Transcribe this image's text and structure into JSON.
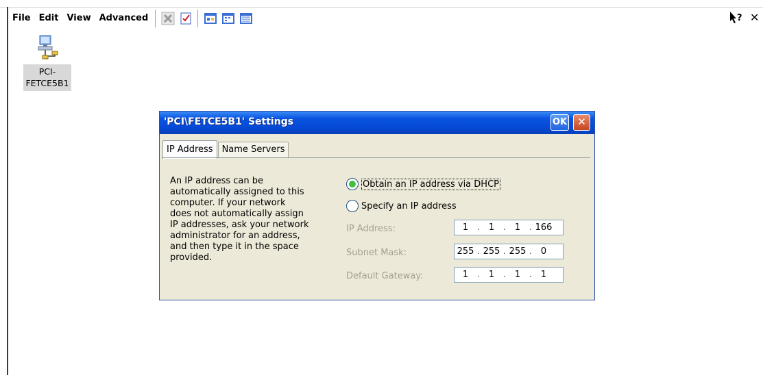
{
  "menu": {
    "file": "File",
    "edit": "Edit",
    "view": "View",
    "advanced": "Advanced"
  },
  "toolbar": {
    "icons": [
      "delete-icon",
      "properties-icon",
      "large-icons-view-icon",
      "small-icons-view-icon",
      "details-view-icon"
    ],
    "help_icon": "help-pointer-icon",
    "close_icon": "close-icon",
    "help_label": "?",
    "close_label": "✕"
  },
  "desktop": {
    "icon_label": "PCI-\nFETCE5B1",
    "icon_name": "network-adapter-icon"
  },
  "dialog": {
    "title": "'PCI\\FETCE5B1' Settings",
    "ok_label": "OK",
    "close_label": "✕",
    "tabs": [
      "IP Address",
      "Name Servers"
    ],
    "description": "An IP address can be\nautomatically assigned to this\ncomputer.  If your network\ndoes not automatically assign\nIP addresses, ask your network\nadministrator for an address,\nand then type it in the space\nprovided.",
    "radio_dhcp": "Obtain an IP address via DHCP",
    "radio_specify": "Specify an IP address",
    "radio_selected": "dhcp",
    "ip_label": "IP Address:",
    "subnet_label": "Subnet Mask:",
    "gateway_label": "Default Gateway:",
    "ip_address": [
      "1",
      "1",
      "1",
      "166"
    ],
    "subnet_mask": [
      "255",
      "255",
      "255",
      "0"
    ],
    "default_gateway": [
      "1",
      "1",
      "1",
      "1"
    ],
    "colors": {
      "titlebar": "#0549d7",
      "dialog_bg": "#ece9d8",
      "radio_selected": "#3fbf3f",
      "disabled_text": "#a3a091"
    }
  }
}
